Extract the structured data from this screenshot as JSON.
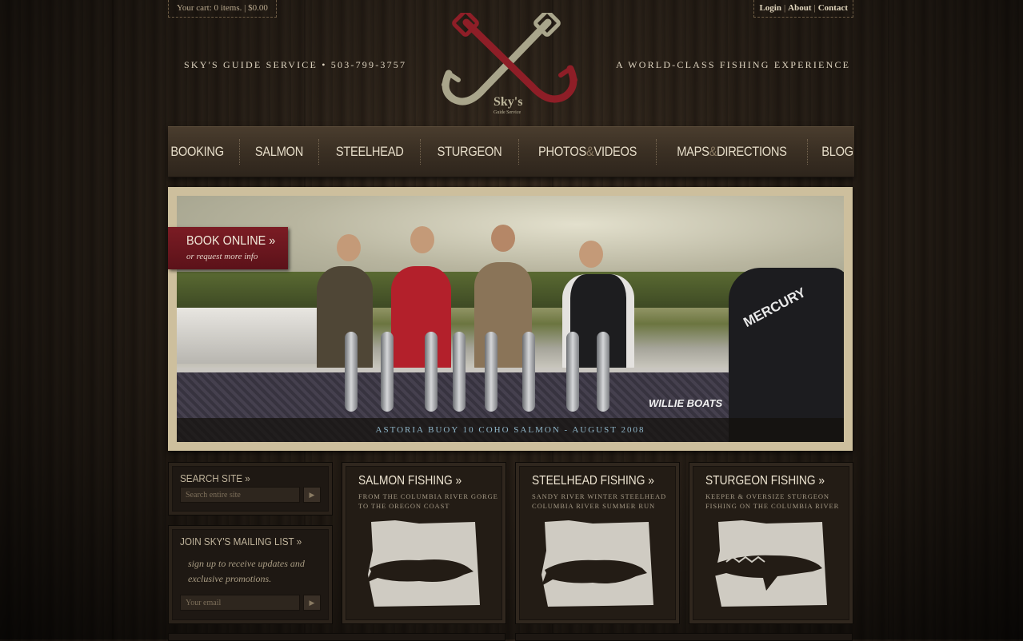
{
  "header": {
    "cart_text": "Your cart: 0 items. | $0.00",
    "links": [
      "Login",
      "About",
      "Contact"
    ],
    "tagline_left": "SKY'S GUIDE SERVICE  •  503-799-3757",
    "tagline_right": "A WORLD-CLASS FISHING EXPERIENCE",
    "logo_text": "Sky's",
    "logo_subtext": "Guide Service"
  },
  "nav": {
    "items": [
      "BOOKING",
      "SALMON",
      "STEELHEAD",
      "STURGEON",
      "PHOTOS",
      "VIDEOS",
      "MAPS",
      "DIRECTIONS",
      "BLOG"
    ],
    "amp": "&"
  },
  "hero": {
    "book_title": "BOOK ONLINE »",
    "book_sub": "or request more info",
    "caption": "ASTORIA BUOY 10 COHO SALMON - AUGUST 2008",
    "motor_brand": "MERCURY",
    "boat_brand": "WILLIE BOATS"
  },
  "sidebar": {
    "search_title": "SEARCH SITE »",
    "search_placeholder": "Search entire site",
    "mailing_title": "JOIN SKY'S MAILING LIST »",
    "mailing_desc": "sign up to receive updates and exclusive promotions.",
    "email_placeholder": "Your email"
  },
  "cards": [
    {
      "title": "SALMON FISHING »",
      "subtitle": "FROM THE COLUMBIA RIVER GORGE TO THE OREGON COAST"
    },
    {
      "title": "STEELHEAD FISHING »",
      "subtitle": "SANDY RIVER WINTER STEELHEAD COLUMBIA RIVER SUMMER RUN"
    },
    {
      "title": "STURGEON FISHING »",
      "subtitle": "KEEPER & OVERSIZE STURGEON FISHING ON THE COLUMBIA RIVER"
    }
  ],
  "colors": {
    "accent_red": "#7b1c24",
    "caption_blue": "#8fb6c9",
    "wood_dark": "#2f251b"
  }
}
